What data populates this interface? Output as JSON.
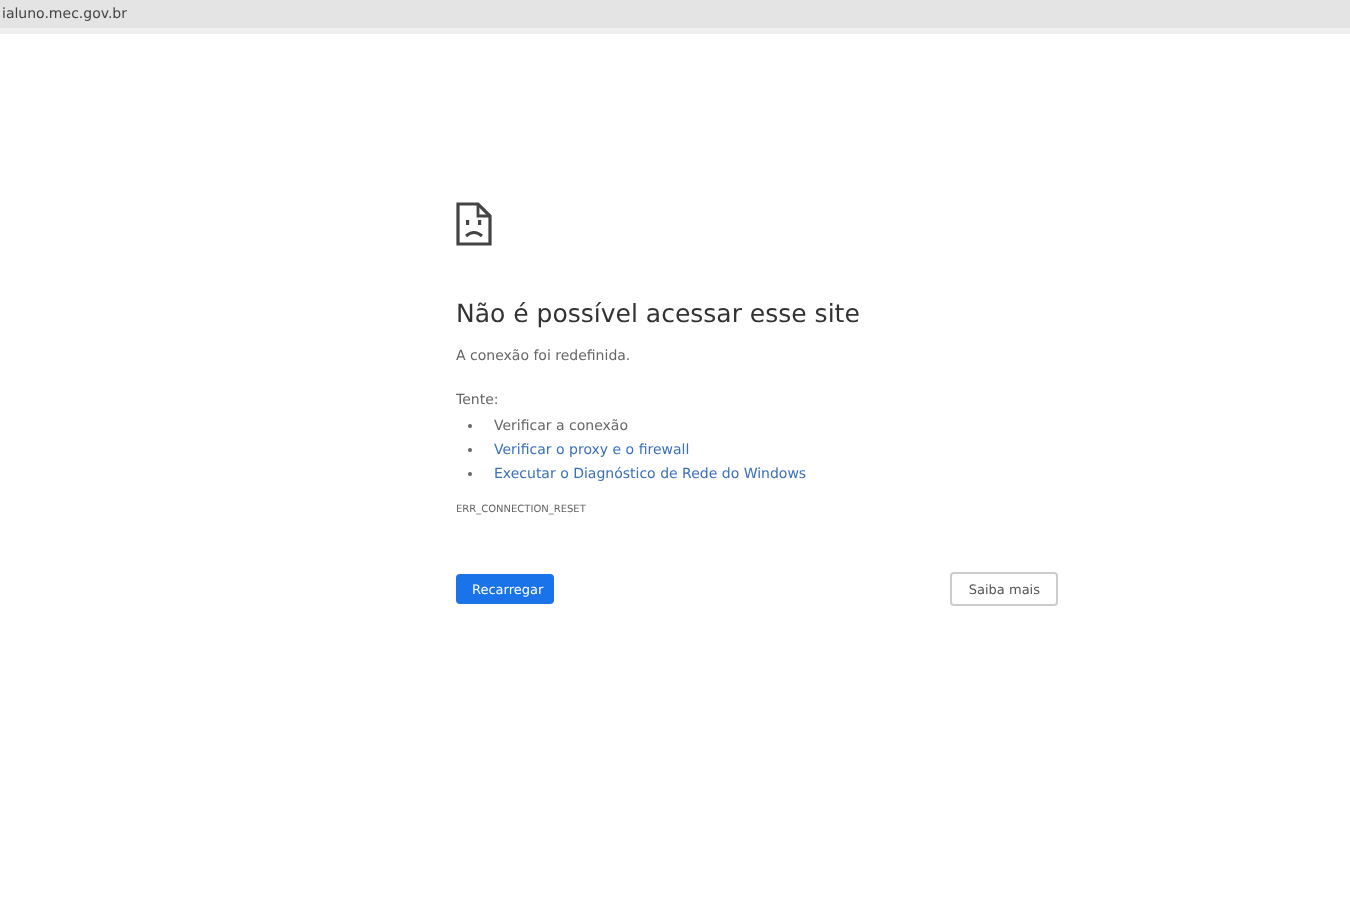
{
  "address_bar": {
    "url": "ialuno.mec.gov.br"
  },
  "error": {
    "title": "Não é possível acessar esse site",
    "message": "A conexão foi redefinida.",
    "try_label": "Tente:",
    "suggestions": [
      {
        "kind": "text",
        "text": "Verificar a conexão"
      },
      {
        "kind": "link",
        "text": "Verificar o proxy e o firewall"
      },
      {
        "kind": "link",
        "text": "Executar o Diagnóstico de Rede do Windows"
      }
    ],
    "code": "ERR_CONNECTION_RESET"
  },
  "buttons": {
    "primary": "Recarregar",
    "secondary": "Saiba mais"
  }
}
